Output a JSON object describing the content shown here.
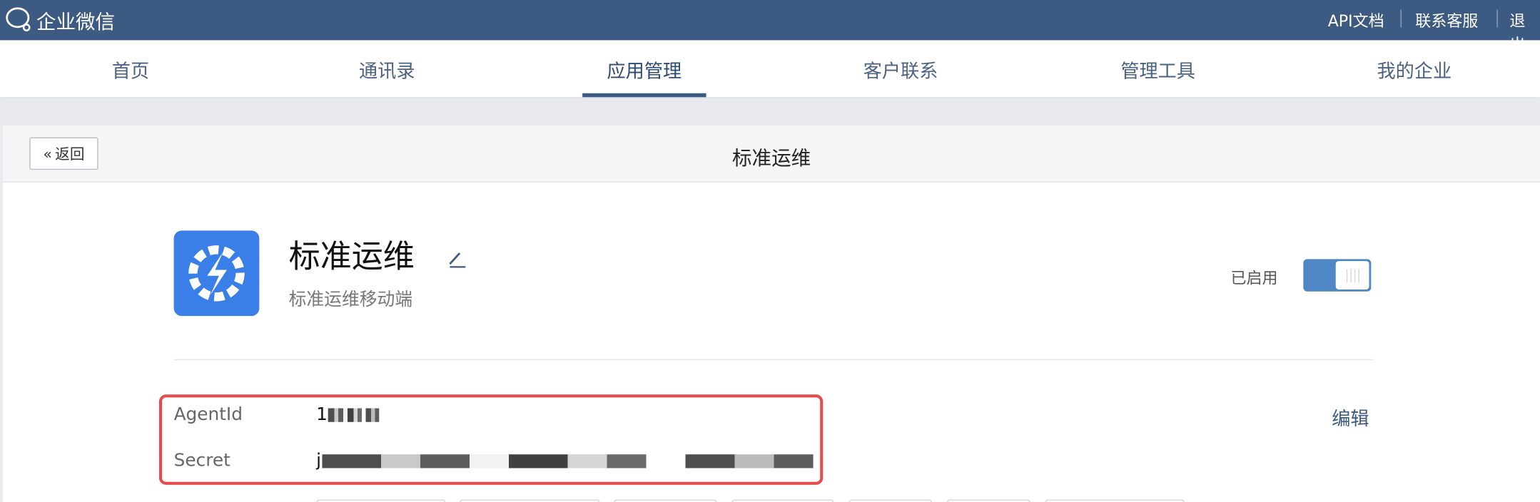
{
  "topbar": {
    "logo_text": "企业微信",
    "links": [
      "API文档",
      "联系客服",
      "退出"
    ]
  },
  "nav": {
    "items": [
      "首页",
      "通讯录",
      "应用管理",
      "客户联系",
      "管理工具",
      "我的企业"
    ],
    "active": "应用管理"
  },
  "page": {
    "back_label": "返回",
    "title": "标准运维"
  },
  "app": {
    "name": "标准运维",
    "description": "标准运维移动端",
    "status_label": "已启用",
    "enabled": true
  },
  "credentials": {
    "agentid_label": "AgentId",
    "agentid_visible": "1",
    "secret_label": "Secret",
    "secret_visible": "j",
    "edit_label": "编辑"
  },
  "colors": {
    "topbar": "#3d5a82",
    "app_icon": "#3a7fe8",
    "highlight": "#e84b4b",
    "toggle": "#4f86c6"
  }
}
